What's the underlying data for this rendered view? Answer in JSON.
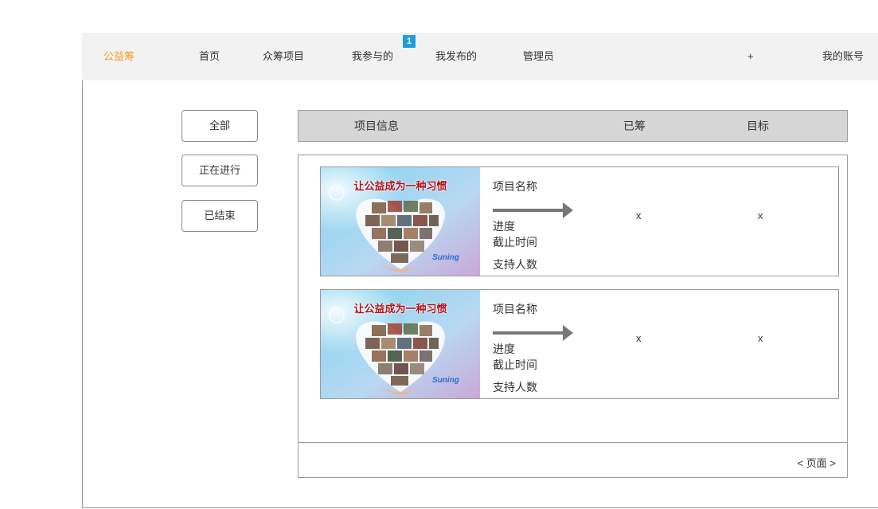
{
  "nav": {
    "brand": "公益筹",
    "items": [
      "首页",
      "众筹项目",
      "我参与的",
      "我发布的",
      "管理员"
    ],
    "badge_count": "1",
    "plus": "+",
    "account": "我的账号",
    "brand_color": "#f0a020",
    "badge_color": "#1e9fdb"
  },
  "filters": [
    "全部",
    "正在进行",
    "已结束"
  ],
  "table_header": {
    "project_info": "项目信息",
    "raised": "已筹",
    "target": "目标"
  },
  "projects": [
    {
      "image_title": "让公益成为一种习惯",
      "image_brand": "Suning",
      "name_label": "项目名称",
      "progress_label": "进度",
      "deadline_label": "截止时间",
      "supporters_label": "支持人数",
      "raised": "x",
      "target": "x"
    },
    {
      "image_title": "让公益成为一种习惯",
      "image_brand": "Suning",
      "name_label": "项目名称",
      "progress_label": "进度",
      "deadline_label": "截止时间",
      "supporters_label": "支持人数",
      "raised": "x",
      "target": "x"
    }
  ],
  "pager": "< 页面 >"
}
